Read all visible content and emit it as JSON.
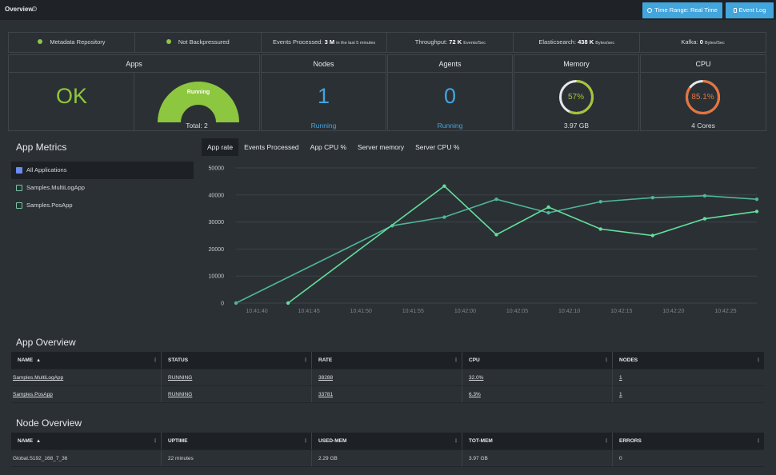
{
  "header": {
    "title": "Overview",
    "time_range_label": "Time Range: Real Time",
    "event_log_label": "Event Log"
  },
  "status": {
    "metadata": "Metadata Repository",
    "backpressure": "Not Backpressured",
    "events_label": "Events Processed:",
    "events_value": "3 M",
    "events_suffix": "in the last 5 minutes",
    "throughput_label": "Throughput:",
    "throughput_value": "72 K",
    "throughput_unit": "Events/Sec",
    "es_label": "Elasticsearch:",
    "es_value": "438 K",
    "es_unit": "Bytes/sec",
    "kafka_label": "Kafka:",
    "kafka_value": "0",
    "kafka_unit": "Bytes/Sec"
  },
  "tiles": {
    "apps": {
      "header": "Apps",
      "status": "OK",
      "gauge_label": "Running",
      "total": "Total: 2"
    },
    "nodes": {
      "header": "Nodes",
      "value": "1",
      "sub": "Running"
    },
    "agents": {
      "header": "Agents",
      "value": "0",
      "sub": "Running"
    },
    "memory": {
      "header": "Memory",
      "percent_label": "57%",
      "percent": 57,
      "sub": "3.97 GB",
      "color": "#a5c43a"
    },
    "cpu": {
      "header": "CPU",
      "percent_label": "85.1%",
      "percent": 85.1,
      "sub": "4 Cores",
      "color": "#e8743b"
    }
  },
  "metrics": {
    "title": "App Metrics",
    "apps": [
      "All Applications",
      "Samples.MultiLogApp",
      "Samples.PosApp"
    ],
    "tabs": [
      "App rate",
      "Events Processed",
      "App CPU %",
      "Server memory",
      "Server CPU %"
    ]
  },
  "chart_data": {
    "type": "line",
    "y_ticks": [
      "50000",
      "40000",
      "30000",
      "20000",
      "10000",
      "0"
    ],
    "x_ticks": [
      "10:41:40",
      "10:41:45",
      "10:41:50",
      "10:41:55",
      "10:42:00",
      "10:42:05",
      "10:42:10",
      "10:42:15",
      "10:42:20",
      "10:42:25"
    ],
    "ylim": [
      0,
      50000
    ],
    "grid": true,
    "series": [
      {
        "color": "#4fb59b",
        "x": [
          "10:41:38",
          "10:41:53",
          "10:41:58",
          "10:42:03",
          "10:42:08",
          "10:42:13",
          "10:42:18",
          "10:42:23",
          "10:42:28"
        ],
        "values": [
          0,
          28600,
          31800,
          38400,
          33400,
          37500,
          39000,
          39700,
          38400
        ]
      },
      {
        "color": "#62e09a",
        "x": [
          "10:41:43",
          "10:41:58",
          "10:42:03",
          "10:42:08",
          "10:42:13",
          "10:42:18",
          "10:42:23",
          "10:42:28"
        ],
        "values": [
          0,
          43300,
          25300,
          35500,
          27400,
          25000,
          31200,
          33900
        ]
      }
    ]
  },
  "app_overview": {
    "title": "App Overview",
    "columns": [
      "NAME",
      "STATUS",
      "RATE",
      "CPU",
      "NODES"
    ],
    "rows": [
      [
        "Samples.MultiLogApp",
        "RUNNING",
        "38288",
        "32.0%",
        "1"
      ],
      [
        "Samples.PosApp",
        "RUNNING",
        "33781",
        "6.3%",
        "1"
      ]
    ]
  },
  "node_overview": {
    "title": "Node Overview",
    "columns": [
      "NAME",
      "UPTIME",
      "USED-MEM",
      "TOT-MEM",
      "ERRORS"
    ],
    "rows": [
      [
        "Global.S192_168_7_36",
        "22 minutes",
        "2.29 GB",
        "3.97 GB",
        "0"
      ]
    ]
  }
}
